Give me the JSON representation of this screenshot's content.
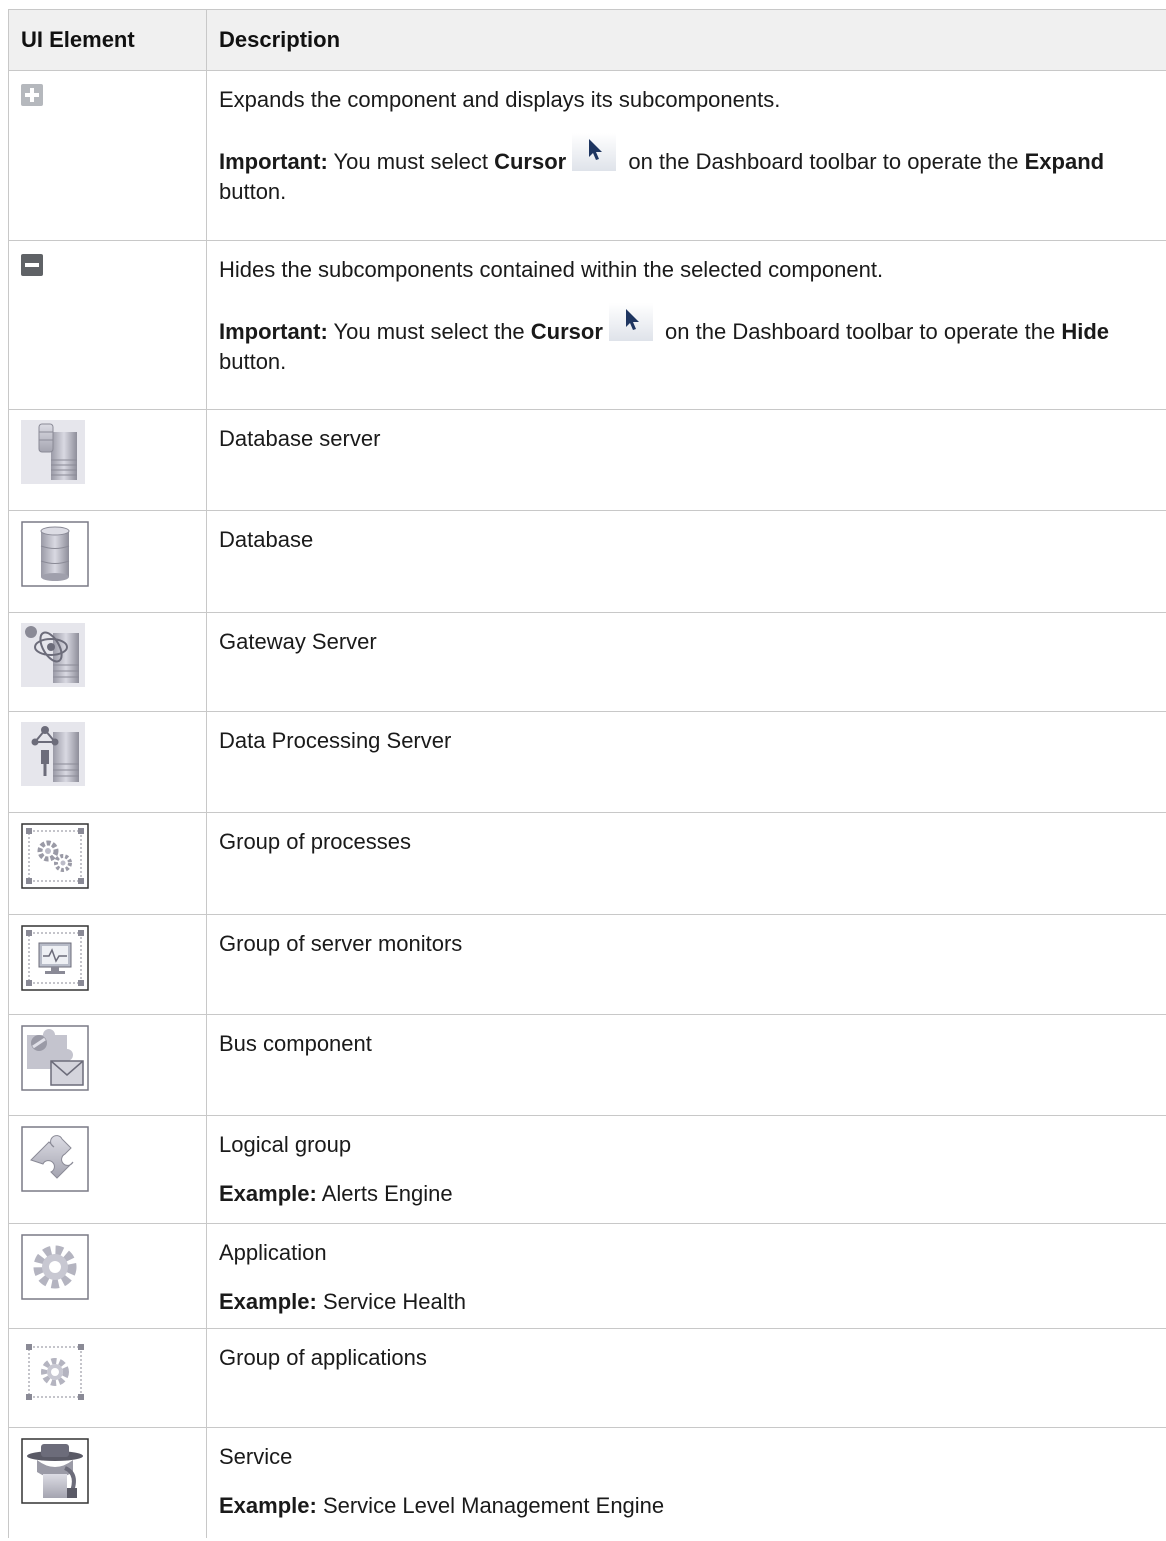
{
  "header": {
    "col1": "UI Element",
    "col2": "Description"
  },
  "rows": {
    "expand": {
      "icon": "plus-square-icon",
      "desc": "Expands the component and displays its subcomponents.",
      "imp_label": "Important:",
      "imp_t1": " You must select ",
      "imp_cursor": "Cursor",
      "imp_t2": " on the Dashboard toolbar to operate the ",
      "imp_button": "Expand",
      "imp_t3": " button."
    },
    "hide": {
      "icon": "minus-square-icon",
      "desc": "Hides the subcomponents contained within the selected component.",
      "imp_label": "Important:",
      "imp_t1": " You must select the ",
      "imp_cursor": "Cursor",
      "imp_t2": " on the Dashboard toolbar to operate the ",
      "imp_button": "Hide",
      "imp_t3": " button."
    },
    "db_server": {
      "icon": "database-server-icon",
      "desc": "Database server"
    },
    "database": {
      "icon": "database-icon",
      "desc": "Database"
    },
    "gateway": {
      "icon": "gateway-server-icon",
      "desc": "Gateway Server"
    },
    "dps": {
      "icon": "data-processing-server-icon",
      "desc": "Data Processing Server"
    },
    "proc_group": {
      "icon": "process-group-icon",
      "desc": "Group of processes"
    },
    "monitor_group": {
      "icon": "server-monitor-group-icon",
      "desc": "Group of server monitors"
    },
    "bus": {
      "icon": "bus-component-icon",
      "desc": "Bus component"
    },
    "logical": {
      "icon": "puzzle-icon",
      "desc": "Logical group",
      "ex_label": "Example:",
      "ex_text": " Alerts Engine"
    },
    "application": {
      "icon": "gear-icon",
      "desc": "Application",
      "ex_label": "Example:",
      "ex_text": " Service Health"
    },
    "app_group": {
      "icon": "application-group-icon",
      "desc": "Group of applications"
    },
    "service": {
      "icon": "service-icon",
      "desc": "Service",
      "ex_label": "Example:",
      "ex_text": " Service Level Management Engine"
    }
  }
}
